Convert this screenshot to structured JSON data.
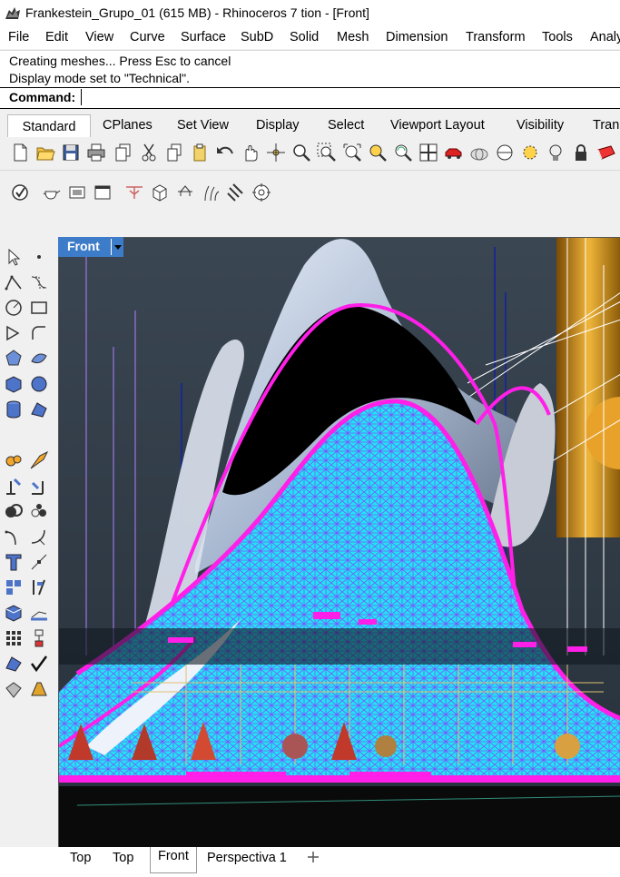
{
  "window": {
    "title": "Frankestein_Grupo_01 (615 MB) - Rhinoceros 7 tion - [Front]"
  },
  "menu": [
    "File",
    "Edit",
    "View",
    "Curve",
    "Surface",
    "SubD",
    "Solid",
    "Mesh",
    "Dimension",
    "Transform",
    "Tools",
    "Analy"
  ],
  "command": {
    "history": [
      "Creating meshes... Press Esc to cancel",
      "Display mode set to \"Technical\"."
    ],
    "prompt_label": "Command:",
    "input_value": ""
  },
  "toolbar_tabs": [
    "Standard",
    "CPlanes",
    "Set View",
    "Display",
    "Select",
    "Viewport Layout",
    "Visibility",
    "Tran"
  ],
  "active_toolbar_tab": "Standard",
  "standard_tools": [
    "new-file-icon",
    "open-file-icon",
    "save-icon",
    "print-icon",
    "copy-icon",
    "cut-icon",
    "copy-clipboard-icon",
    "paste-icon",
    "undo-icon",
    "pan-hand-icon",
    "rotate-view-icon",
    "zoom-icon",
    "zoom-window-icon",
    "zoom-extents-icon",
    "zoom-selected-icon",
    "rotate-camera-icon",
    "four-viewports-icon",
    "car-icon",
    "wireframe-sphere-icon",
    "shaded-sphere-icon",
    "rendered-sphere-icon",
    "light-bulb-icon",
    "lock-icon",
    "material-icon"
  ],
  "row2_tools": [
    "check-icon",
    "teapot-icon",
    "render-window-icon",
    "viewport-window-icon",
    "surface-analysis-icon",
    "box-plugin-icon",
    "drone-icon",
    "grass-icon",
    "cylinder-slice-icon",
    "target-gizmo-icon"
  ],
  "left_tools": [
    "select-arrow-icon",
    "point-icon",
    "polyline-icon",
    "curve-icon",
    "circle-icon",
    "rectangle-icon",
    "polygon-icon",
    "arc-icon",
    "fillet-icon",
    "surface-icon",
    "box-icon",
    "sphere-icon",
    "cylinder-icon",
    "sphere-blue-icon",
    "extrude-icon",
    "blend-icon",
    "gear-icon",
    "explode-icon",
    "boolean-icon",
    "split-icon",
    "group-icon",
    "ungroup-icon",
    "curve-point-icon",
    "edit-points-icon",
    "text-icon",
    "dimension-icon",
    "array-icon",
    "mirror-icon",
    "block-icon",
    "cage-icon",
    "grid-array-icon",
    "scale-icon",
    "layer-icon",
    "checkmark-icon",
    "mesh-icon",
    "light-icon"
  ],
  "viewport": {
    "name": "Front",
    "colors": {
      "sky": "#2f3a45",
      "magenta": "#ff1fe8",
      "cyan": "#22f0ff",
      "violet": "#8a66ff",
      "gold": "#d39a1c",
      "ground": "#0a0a0a"
    }
  },
  "bottom_tabs": [
    "Top",
    "Top",
    "Front",
    "Perspectiva 1"
  ],
  "active_bottom_tab": "Front",
  "add_tab_icon": "plus-icon"
}
